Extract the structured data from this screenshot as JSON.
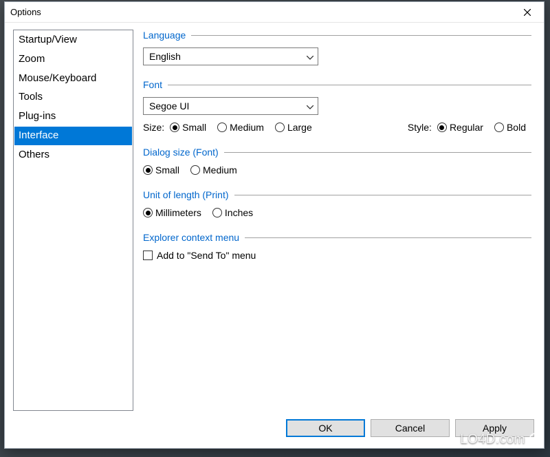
{
  "window": {
    "title": "Options"
  },
  "sidebar": {
    "items": [
      {
        "label": "Startup/View",
        "selected": false
      },
      {
        "label": "Zoom",
        "selected": false
      },
      {
        "label": "Mouse/Keyboard",
        "selected": false
      },
      {
        "label": "Tools",
        "selected": false
      },
      {
        "label": "Plug-ins",
        "selected": false
      },
      {
        "label": "Interface",
        "selected": true
      },
      {
        "label": "Others",
        "selected": false
      }
    ]
  },
  "groups": {
    "language": {
      "header": "Language",
      "value": "English"
    },
    "font": {
      "header": "Font",
      "value": "Segoe UI",
      "size_label": "Size:",
      "size_options": [
        "Small",
        "Medium",
        "Large"
      ],
      "size_selected": "Small",
      "style_label": "Style:",
      "style_options": [
        "Regular",
        "Bold"
      ],
      "style_selected": "Regular"
    },
    "dialog_size": {
      "header": "Dialog size (Font)",
      "options": [
        "Small",
        "Medium"
      ],
      "selected": "Small"
    },
    "unit": {
      "header": "Unit of length (Print)",
      "options": [
        "Millimeters",
        "Inches"
      ],
      "selected": "Millimeters"
    },
    "context_menu": {
      "header": "Explorer context menu",
      "checkbox_label": "Add to \"Send To\" menu",
      "checked": false
    }
  },
  "footer": {
    "ok": "OK",
    "cancel": "Cancel",
    "apply": "Apply"
  },
  "watermark": "LO4D.com"
}
